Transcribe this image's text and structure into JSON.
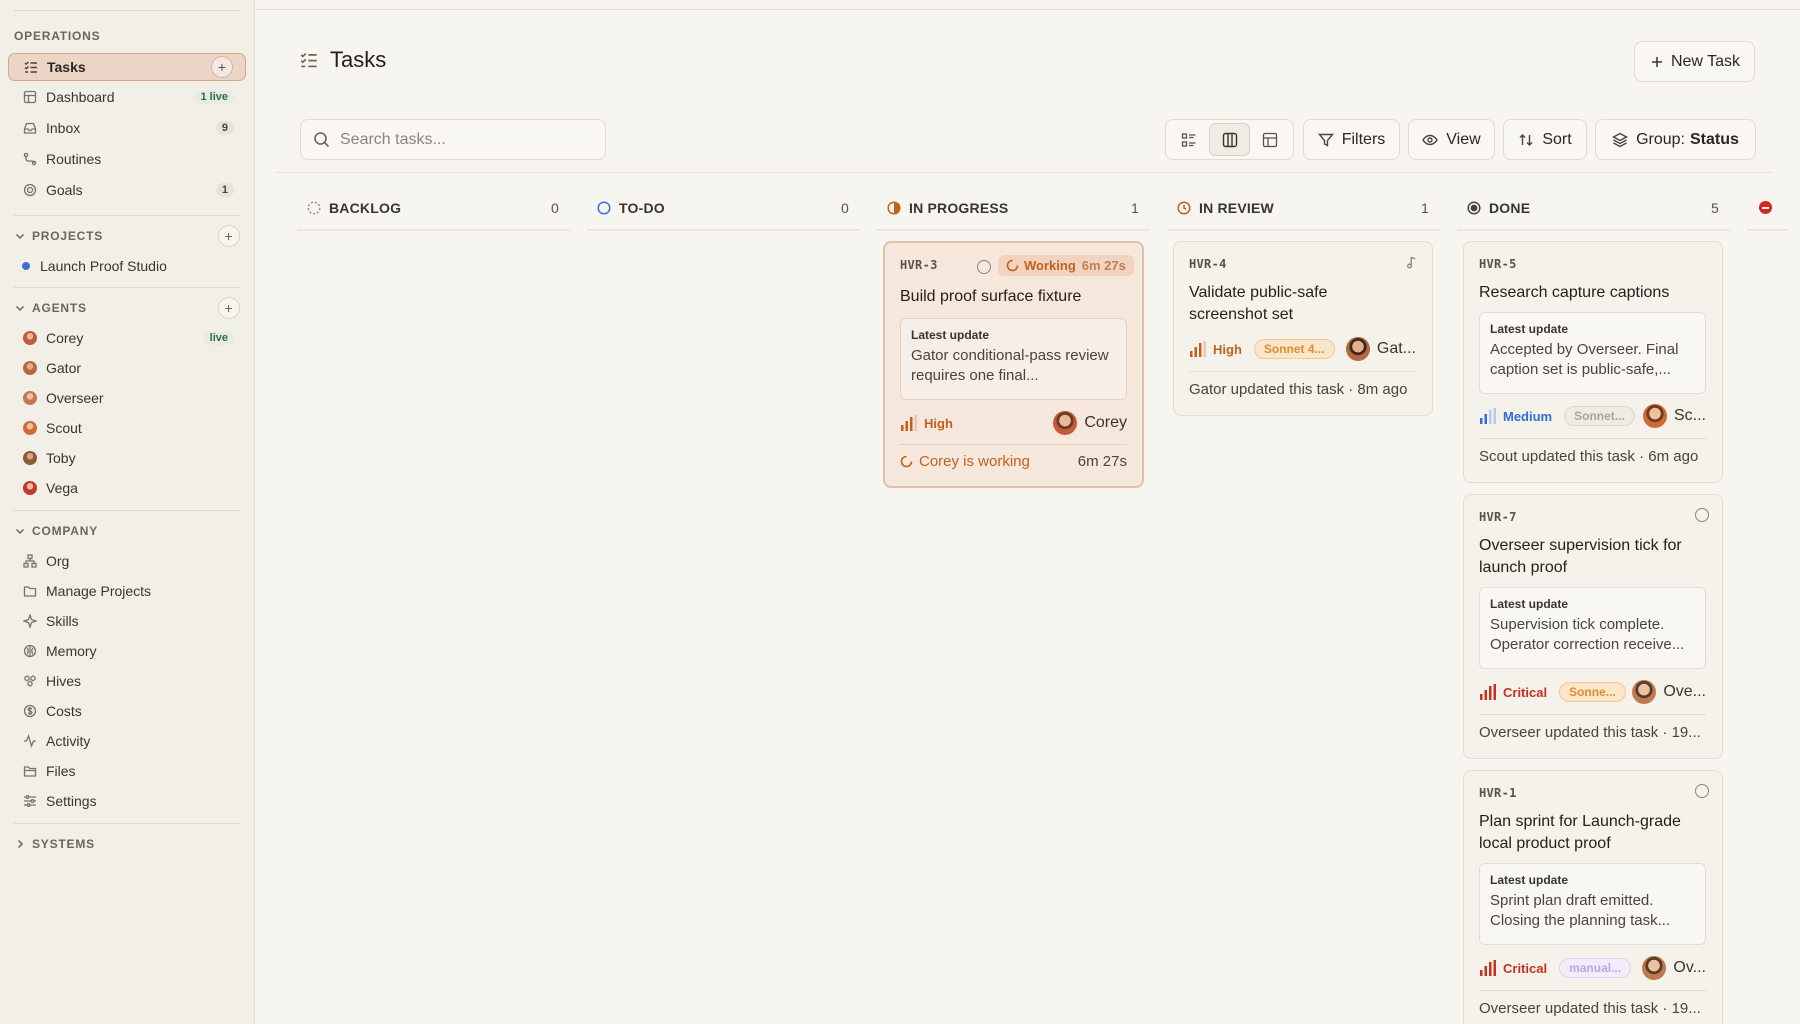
{
  "sidebar": {
    "operations_label": "OPERATIONS",
    "operations": [
      {
        "label": "Tasks",
        "icon": "tasks-icon"
      },
      {
        "label": "Dashboard",
        "icon": "dashboard-icon",
        "badge": "1 live"
      },
      {
        "label": "Inbox",
        "icon": "inbox-icon",
        "badge": "9"
      },
      {
        "label": "Routines",
        "icon": "routines-icon"
      },
      {
        "label": "Goals",
        "icon": "goals-icon",
        "badge": "1"
      }
    ],
    "projects_label": "PROJECTS",
    "projects": [
      {
        "label": "Launch Proof Studio",
        "color": "#3d6fd8"
      }
    ],
    "agents_label": "AGENTS",
    "agents": [
      {
        "label": "Corey",
        "badge": "live",
        "color": "#c25b3a"
      },
      {
        "label": "Gator",
        "color": "#b2693f"
      },
      {
        "label": "Overseer",
        "color": "#c07a4e"
      },
      {
        "label": "Scout",
        "color": "#d06a38"
      },
      {
        "label": "Toby",
        "color": "#8c5a3c"
      },
      {
        "label": "Vega",
        "color": "#c0392b"
      }
    ],
    "company_label": "COMPANY",
    "company": [
      {
        "label": "Org",
        "icon": "org-icon"
      },
      {
        "label": "Manage Projects",
        "icon": "folder-icon"
      },
      {
        "label": "Skills",
        "icon": "skills-icon"
      },
      {
        "label": "Memory",
        "icon": "memory-icon"
      },
      {
        "label": "Hives",
        "icon": "hives-icon"
      },
      {
        "label": "Costs",
        "icon": "costs-icon"
      },
      {
        "label": "Activity",
        "icon": "activity-icon"
      },
      {
        "label": "Files",
        "icon": "files-icon"
      },
      {
        "label": "Settings",
        "icon": "settings-icon"
      }
    ],
    "systems_label": "SYSTEMS"
  },
  "header": {
    "title": "Tasks",
    "new_task_label": "New Task",
    "search_placeholder": "Search tasks...",
    "filters_label": "Filters",
    "view_label": "View",
    "sort_label": "Sort",
    "group_prefix": "Group:",
    "group_value": "Status"
  },
  "columns": [
    {
      "label": "BACKLOG",
      "count": "0"
    },
    {
      "label": "TO-DO",
      "count": "0"
    },
    {
      "label": "IN PROGRESS",
      "count": "1"
    },
    {
      "label": "IN REVIEW",
      "count": "1"
    },
    {
      "label": "DONE",
      "count": "5"
    }
  ],
  "cards": {
    "hvr3": {
      "id": "HVR-3",
      "status_label": "Working",
      "status_time": "6m 27s",
      "title": "Build proof surface fixture",
      "update_label": "Latest update",
      "update_text": "Gator conditional-pass review requires one final...",
      "priority": "High",
      "assignee": "Corey",
      "footer_text": "Corey is working",
      "footer_time": "6m 27s"
    },
    "hvr4": {
      "id": "HVR-4",
      "title_line1": "Validate public-safe",
      "title_line2": "screenshot set",
      "priority": "High",
      "model": "Sonnet 4...",
      "assignee": "Gat...",
      "footer_text": "Gator updated this task · 8m ago"
    },
    "hvr5": {
      "id": "HVR-5",
      "title": "Research capture captions",
      "update_label": "Latest update",
      "update_text_line1": "Accepted by Overseer. Final",
      "update_text_line2": "caption set is public-safe,...",
      "priority": "Medium",
      "model": "Sonnet...",
      "assignee": "Sc...",
      "footer_text": "Scout updated this task · 6m ago"
    },
    "hvr7": {
      "id": "HVR-7",
      "title_line1": "Overseer supervision tick for",
      "title_line2": "launch proof",
      "update_label": "Latest update",
      "update_text_line1": "Supervision tick complete.",
      "update_text_line2": "Operator correction receive...",
      "priority": "Critical",
      "model": "Sonne...",
      "assignee": "Ove...",
      "footer_text": "Overseer updated this task · 19..."
    },
    "hvr1": {
      "id": "HVR-1",
      "title_line1": "Plan sprint for Launch-grade",
      "title_line2": "local product proof",
      "update_label": "Latest update",
      "update_text_line1": "Sprint plan draft emitted.",
      "update_text_line2": "Closing the planning task...",
      "priority": "Critical",
      "model": "manual...",
      "assignee": "Ov...",
      "footer_text": "Overseer updated this task · 19..."
    }
  },
  "colors": {
    "accent": "#d7a58a",
    "high": "#c2611b",
    "medium": "#2f6fd8",
    "critical": "#c9301e",
    "working": "#c2611b"
  }
}
